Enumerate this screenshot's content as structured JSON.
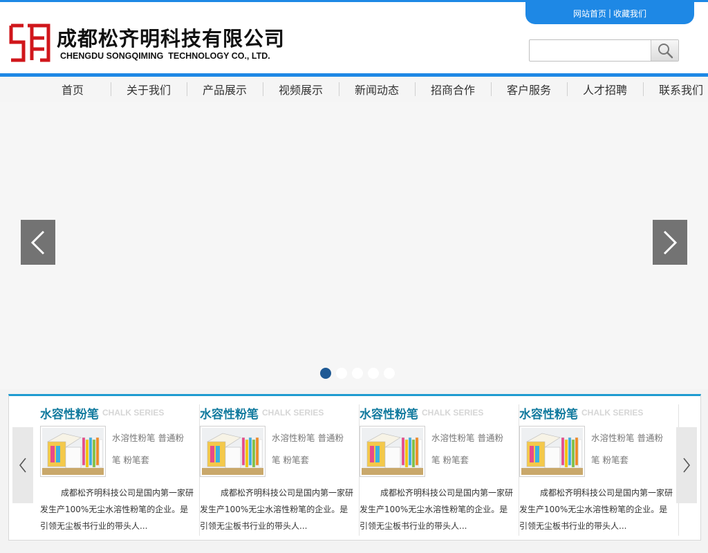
{
  "header": {
    "company_cn": "成都松齐明科技有限公司",
    "company_en": "CHENGDU SONGQIMING  TECHNOLOGY CO., LTD.",
    "toplinks": {
      "home": "网站首页",
      "separator": "|",
      "favorite": "收藏我们"
    },
    "search": {
      "value": "",
      "placeholder": ""
    }
  },
  "nav": [
    {
      "label": "首页"
    },
    {
      "label": "关于我们"
    },
    {
      "label": "产品展示"
    },
    {
      "label": "视频展示"
    },
    {
      "label": "新闻动态"
    },
    {
      "label": "招商合作"
    },
    {
      "label": "客户服务"
    },
    {
      "label": "人才招聘"
    },
    {
      "label": "联系我们"
    }
  ],
  "banner": {
    "slide_count": 5,
    "active_index": 0
  },
  "products": [
    {
      "title": "水容性粉笔",
      "subtitle": "CHALK SERIES",
      "tags": "水溶性粉笔 普通粉笔 粉笔套",
      "desc": "成都松齐明科技公司是国内第一家研发生产100%无尘水溶性粉笔的企业。是引领无尘板书行业的带头人..."
    },
    {
      "title": "水容性粉笔",
      "subtitle": "CHALK SERIES",
      "tags": "水溶性粉笔 普通粉笔 粉笔套",
      "desc": "成都松齐明科技公司是国内第一家研发生产100%无尘水溶性粉笔的企业。是引领无尘板书行业的带头人..."
    },
    {
      "title": "水容性粉笔",
      "subtitle": "CHALK SERIES",
      "tags": "水溶性粉笔 普通粉笔 粉笔套",
      "desc": "成都松齐明科技公司是国内第一家研发生产100%无尘水溶性粉笔的企业。是引领无尘板书行业的带头人..."
    },
    {
      "title": "水容性粉笔",
      "subtitle": "CHALK SERIES",
      "tags": "水溶性粉笔 普通粉笔 粉笔套",
      "desc": "成都松齐明科技公司是国内第一家研发生产100%无尘水溶性粉笔的企业。是引领无尘板书行业的带头人..."
    }
  ],
  "colors": {
    "accent": "#1e88e5",
    "title": "#117a9e",
    "active_dot": "#1f5a95",
    "logo": "#d0161b"
  },
  "icons": {
    "logo": "company-logo",
    "search": "search-icon",
    "banner_prev": "chevron-left-icon",
    "banner_next": "chevron-right-icon",
    "strip_prev": "chevron-left-icon",
    "strip_next": "chevron-right-icon"
  }
}
